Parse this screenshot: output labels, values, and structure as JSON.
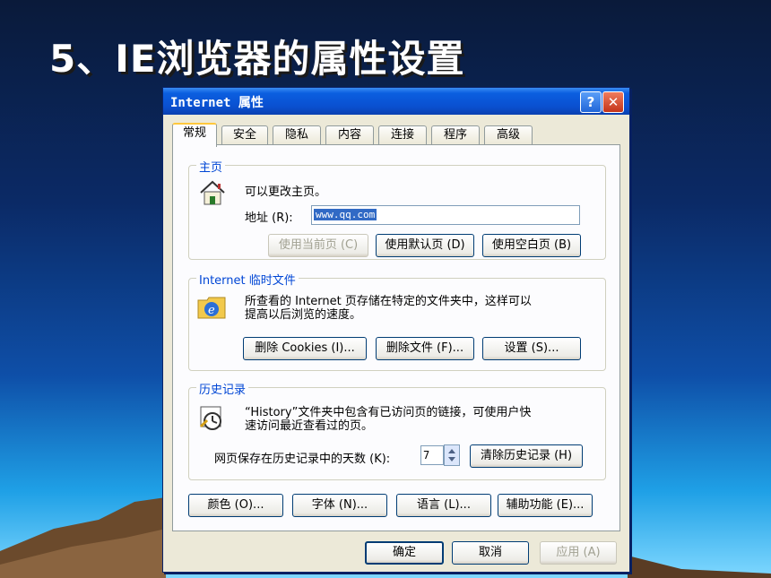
{
  "slide": {
    "title": "5、IE浏览器的属性设置"
  },
  "dialog": {
    "title": "Internet 属性",
    "help_glyph": "?",
    "close_glyph": "✕",
    "tabs": [
      "常规",
      "安全",
      "隐私",
      "内容",
      "连接",
      "程序",
      "高级"
    ],
    "active_tab": "常规",
    "homepage": {
      "group_title": "主页",
      "description": "可以更改主页。",
      "address_label": "地址 (R):",
      "address_value": "www.qq.com",
      "buttons": [
        "使用当前页 (C)",
        "使用默认页 (D)",
        "使用空白页 (B)"
      ]
    },
    "temp_files": {
      "group_title": "Internet 临时文件",
      "description_line1": "所查看的 Internet 页存储在特定的文件夹中，这样可以",
      "description_line2": "提高以后浏览的速度。",
      "buttons": [
        "删除 Cookies (I)...",
        "删除文件 (F)...",
        "设置 (S)..."
      ]
    },
    "history": {
      "group_title": "历史记录",
      "description_line1": "“History”文件夹中包含有已访问页的链接，可使用户快",
      "description_line2": "速访问最近查看过的页。",
      "days_label": "网页保存在历史记录中的天数 (K):",
      "days_value": "7",
      "clear_button": "清除历史记录 (H)"
    },
    "bottom_buttons": [
      "颜色 (O)...",
      "字体 (N)...",
      "语言 (L)...",
      "辅助功能 (E)..."
    ],
    "footer_buttons": {
      "ok": "确定",
      "cancel": "取消",
      "apply": "应用 (A)"
    }
  },
  "colors": {
    "group_title": "#0046d5",
    "titlebar": "#0a50d0"
  }
}
